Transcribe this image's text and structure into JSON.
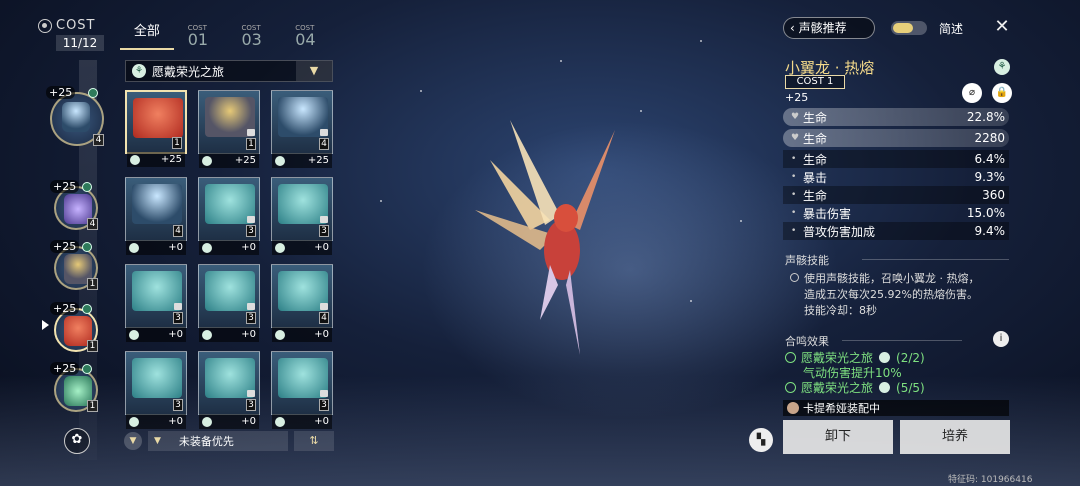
{
  "rail": {
    "cost_label": "COST",
    "cost_count": "11/12",
    "slots": [
      {
        "level": "+25",
        "cost": "4"
      },
      {
        "level": "+25",
        "cost": "4"
      },
      {
        "level": "+25",
        "cost": "1"
      },
      {
        "level": "+25",
        "cost": "1"
      },
      {
        "level": "+25",
        "cost": "1"
      }
    ]
  },
  "tabs": [
    {
      "label": "全部"
    },
    {
      "cap": "COST",
      "num": "01"
    },
    {
      "cap": "COST",
      "num": "03"
    },
    {
      "cap": "COST",
      "num": "04"
    }
  ],
  "set_filter": {
    "label": "愿戴荣光之旅",
    "set_icon": "set-icon",
    "chevron": "chevron-down-icon"
  },
  "grid": [
    {
      "type": "red",
      "cost": "1",
      "level": "+25",
      "locked": false
    },
    {
      "type": "hood",
      "cost": "1",
      "level": "+25",
      "locked": true
    },
    {
      "type": "ghost",
      "cost": "4",
      "level": "+25",
      "locked": true
    },
    {
      "type": "ghost",
      "cost": "4",
      "level": "+0",
      "locked": false
    },
    {
      "type": "teal",
      "cost": "3",
      "level": "+0",
      "locked": true
    },
    {
      "type": "teal",
      "cost": "3",
      "level": "+0",
      "locked": true
    },
    {
      "type": "teal",
      "cost": "3",
      "level": "+0",
      "locked": true
    },
    {
      "type": "teal",
      "cost": "3",
      "level": "+0",
      "locked": true
    },
    {
      "type": "teal",
      "cost": "4",
      "level": "+0",
      "locked": true
    },
    {
      "type": "teal",
      "cost": "3",
      "level": "+0",
      "locked": false
    },
    {
      "type": "teal",
      "cost": "3",
      "level": "+0",
      "locked": true
    },
    {
      "type": "teal",
      "cost": "3",
      "level": "+0",
      "locked": true
    }
  ],
  "filter_bar": {
    "sort_label": "未装备优先",
    "sort_glyph": "⇅"
  },
  "top_right": {
    "recommend_label": "声骸推荐",
    "brief_label": "简述"
  },
  "echo": {
    "name": "小翼龙 · 热熔",
    "cost": "COST 1",
    "level": "+25",
    "main_stats": [
      {
        "name": "生命",
        "value": "22.8%"
      },
      {
        "name": "生命",
        "value": "2280"
      }
    ],
    "sub_stats": [
      {
        "name": "生命",
        "value": "6.4%"
      },
      {
        "name": "暴击",
        "value": "9.3%"
      },
      {
        "name": "生命",
        "value": "360"
      },
      {
        "name": "暴击伤害",
        "value": "15.0%"
      },
      {
        "name": "普攻伤害加成",
        "value": "9.4%"
      }
    ]
  },
  "skill": {
    "title": "声骸技能",
    "line1": "使用声骸技能，召唤小翼龙 · 热熔，",
    "line2": "造成五次每次25.92%的热熔伤害。",
    "line3": "技能冷却：8秒"
  },
  "resonance": {
    "title": "合鸣效果",
    "entries": [
      {
        "name": "愿戴荣光之旅",
        "count": "(2/2)",
        "effect": "气动伤害提升10%"
      },
      {
        "name": "愿戴荣光之旅",
        "count": "(5/5)"
      }
    ]
  },
  "equipped_by": "卡提希娅装配中",
  "buttons": {
    "unequip": "卸下",
    "cultivate": "培养"
  },
  "uid": "特征码: 101966416",
  "colors": {
    "accent": "#f3d98a",
    "set_green": "#7ee080"
  }
}
